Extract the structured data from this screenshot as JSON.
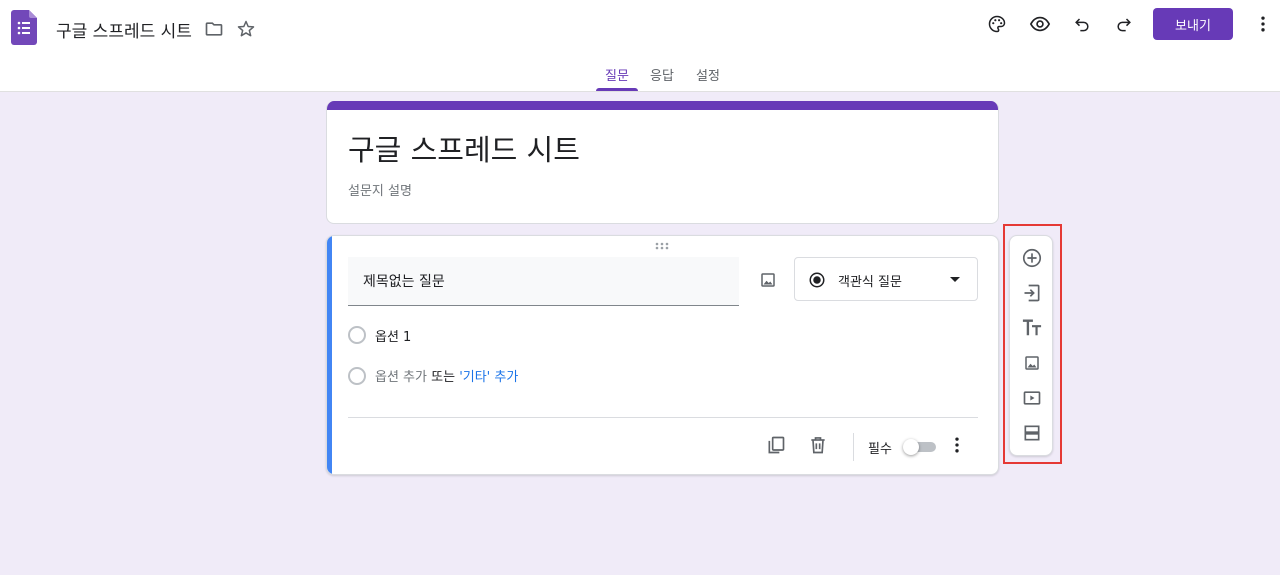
{
  "app": {
    "title": "구글 스프레드 시트",
    "send_label": "보내기",
    "accent_color": "#673ab7",
    "tabs": [
      {
        "label": "질문",
        "active": true
      },
      {
        "label": "응답",
        "active": false
      },
      {
        "label": "설정",
        "active": false
      }
    ]
  },
  "form": {
    "title": "구글 스프레드 시트",
    "description": "설문지 설명"
  },
  "question": {
    "title": "제목없는 질문",
    "type": "객관식 질문",
    "options": [
      "옵션 1"
    ],
    "add_option_label": "옵션 추가",
    "or_label": "또는",
    "add_other_label": "'기타' 추가",
    "required_label": "필수",
    "required": false
  },
  "toolbar": {
    "items": [
      "add-question-icon",
      "import-questions-icon",
      "add-title-icon",
      "add-image-icon",
      "add-video-icon",
      "add-section-icon"
    ]
  }
}
